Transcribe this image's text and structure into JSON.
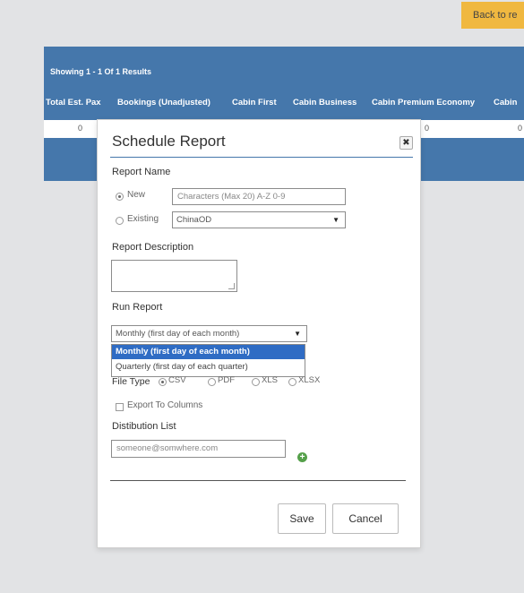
{
  "back_button": {
    "label": "Back to re"
  },
  "results": {
    "showing_text": "Showing 1 - 1 Of 1 Results",
    "columns": [
      "Total Est. Pax",
      "Bookings (Unadjusted)",
      "Cabin First",
      "Cabin Business",
      "Cabin Premium Economy",
      "Cabin"
    ],
    "row": [
      "0",
      "0",
      "0"
    ]
  },
  "modal": {
    "title": "Schedule Report",
    "close_label": "✖",
    "report_name_label": "Report Name",
    "new_label": "New",
    "new_placeholder": "Characters (Max 20) A-Z 0-9",
    "existing_label": "Existing",
    "existing_value": "ChinaOD",
    "report_description_label": "Report Description",
    "run_report_label": "Run Report",
    "run_report_value": "Monthly (first day of each month)",
    "run_report_options": [
      "Monthly (first day of each month)",
      "Quarterly (first day of each quarter)"
    ],
    "file_type_label": "File Type",
    "file_types": [
      "CSV",
      "PDF",
      "XLS",
      "XLSX"
    ],
    "selected_file_type": "CSV",
    "export_columns_label": "Export To Columns",
    "distribution_label": "Distibution List",
    "distribution_placeholder": "someone@somwhere.com",
    "save_label": "Save",
    "cancel_label": "Cancel"
  },
  "colors": {
    "header_blue": "#4577ab",
    "accent_orange": "#f0b840",
    "add_green": "#55a04a",
    "selected_option": "#2f6cc4"
  }
}
